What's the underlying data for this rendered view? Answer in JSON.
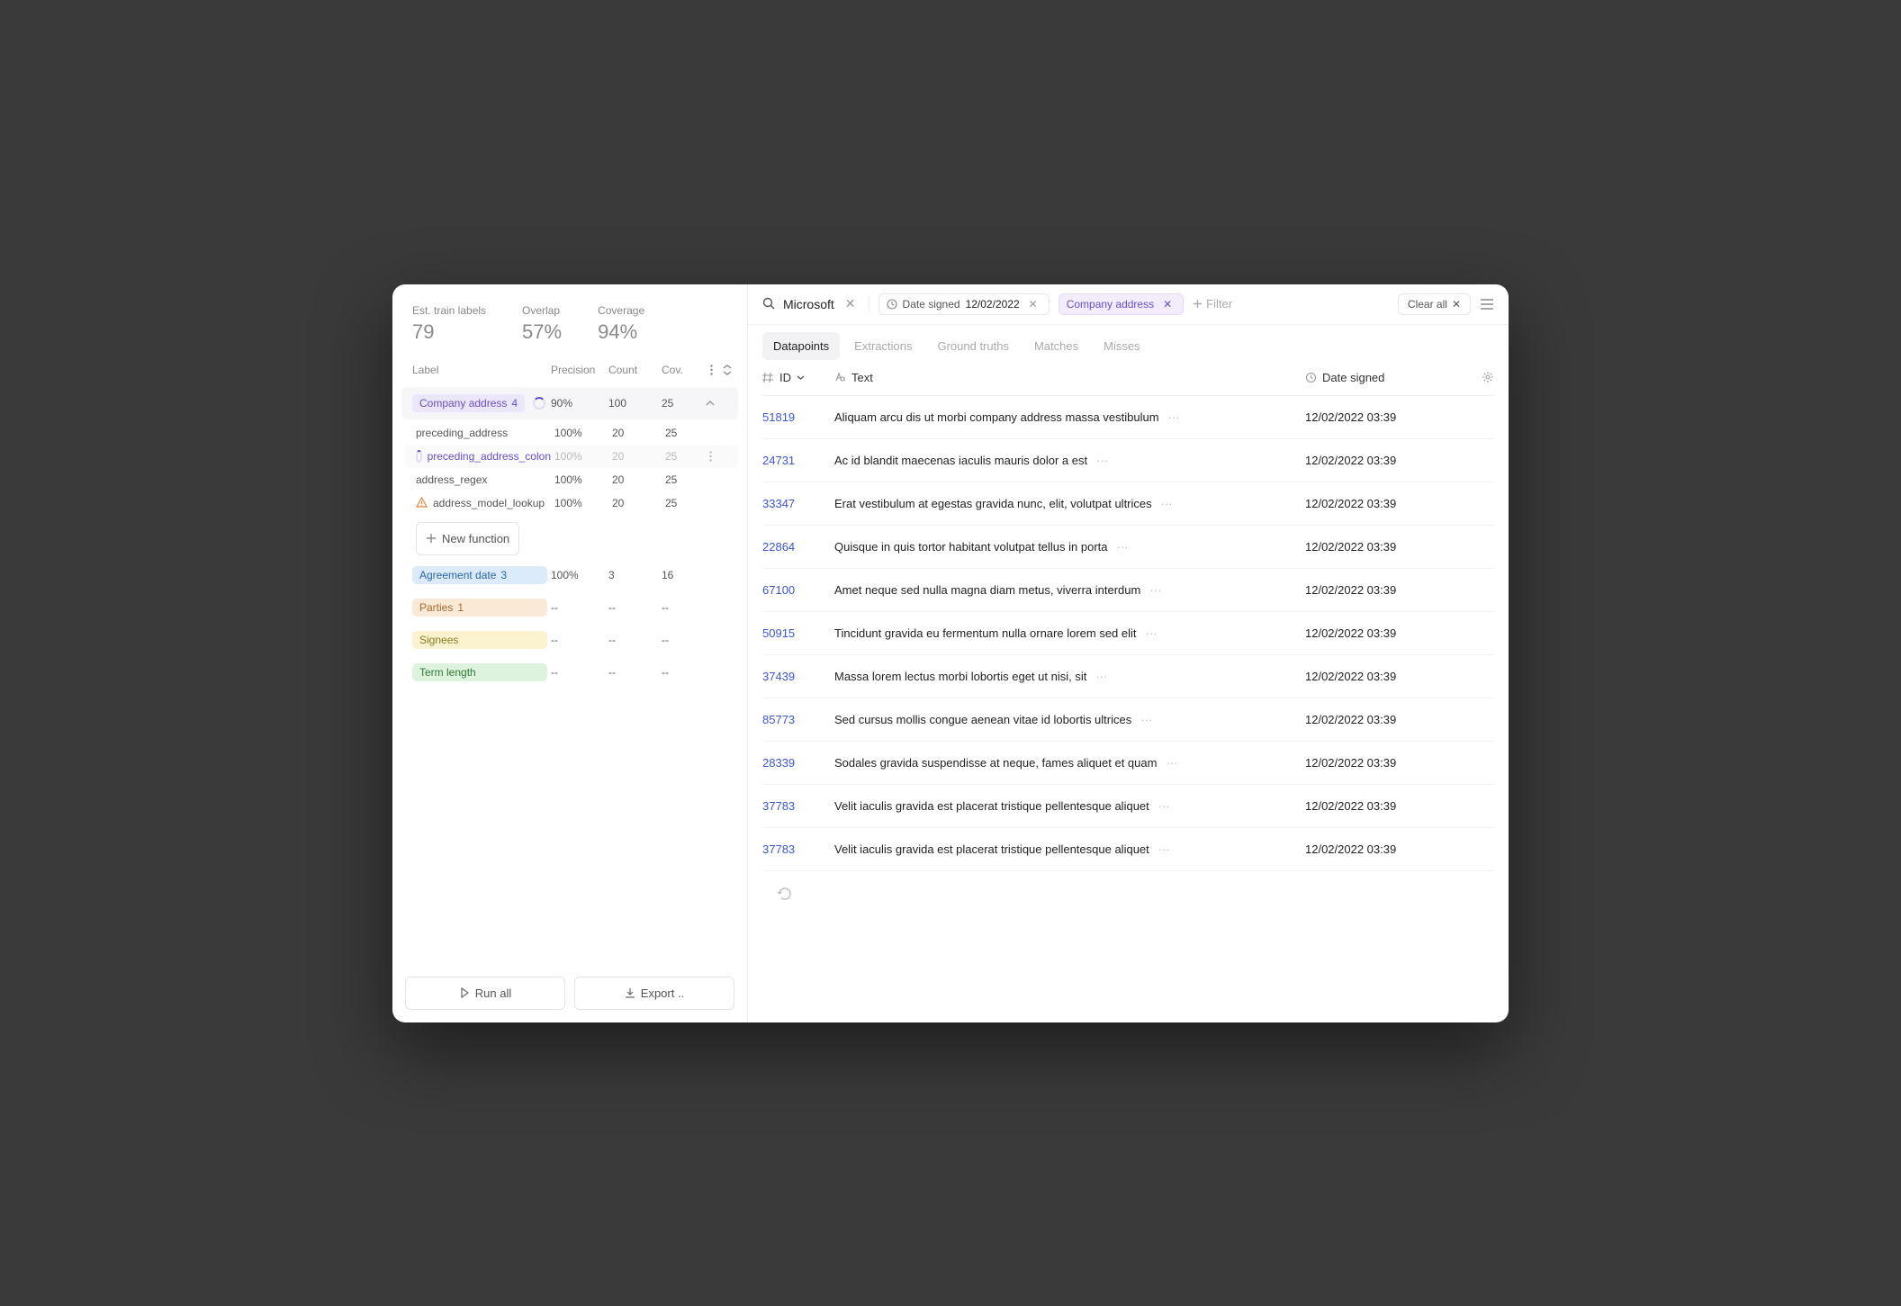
{
  "sidebar": {
    "metrics": [
      {
        "label": "Est. train labels",
        "value": "79"
      },
      {
        "label": "Overlap",
        "value": "57%"
      },
      {
        "label": "Coverage",
        "value": "94%"
      }
    ],
    "columns": {
      "label": "Label",
      "precision": "Precision",
      "count": "Count",
      "cov": "Cov."
    },
    "labels": [
      {
        "name": "Company address",
        "count_badge": "4",
        "color": "purple",
        "loading": true,
        "precision": "90%",
        "count": "100",
        "cov": "25",
        "expanded": true,
        "subs": [
          {
            "name": "preceding_address",
            "precision": "100%",
            "count": "20",
            "cov": "25"
          },
          {
            "name": "preceding_address_colon",
            "precision": "100%",
            "count": "20",
            "cov": "25",
            "loading": true,
            "active": true,
            "muted": true
          },
          {
            "name": "address_regex",
            "precision": "100%",
            "count": "20",
            "cov": "25"
          },
          {
            "name": "address_model_lookup",
            "precision": "100%",
            "count": "20",
            "cov": "25",
            "warn": true
          }
        ]
      },
      {
        "name": "Agreement date",
        "count_badge": "3",
        "color": "blue",
        "precision": "100%",
        "count": "3",
        "cov": "16"
      },
      {
        "name": "Parties",
        "count_badge": "1",
        "color": "orange",
        "precision": "--",
        "count": "--",
        "cov": "--"
      },
      {
        "name": "Signees",
        "color": "yellow",
        "precision": "--",
        "count": "--",
        "cov": "--"
      },
      {
        "name": "Term length",
        "color": "green",
        "precision": "--",
        "count": "--",
        "cov": "--"
      }
    ],
    "new_function": "New function",
    "footer": {
      "run_all": "Run all",
      "export": "Export .."
    }
  },
  "header": {
    "search_value": "Microsoft",
    "chips": [
      {
        "label": "Date signed",
        "value": "12/02/2022",
        "icon": "clock"
      },
      {
        "label": "Company address",
        "icon": "none",
        "purple": true
      }
    ],
    "filter_label": "Filter",
    "clear_all": "Clear all"
  },
  "tabs": [
    "Datapoints",
    "Extractions",
    "Ground truths",
    "Matches",
    "Misses"
  ],
  "active_tab": 0,
  "table": {
    "columns": {
      "id": "ID",
      "text": "Text",
      "date": "Date signed"
    },
    "rows": [
      {
        "id": "51819",
        "text": "Aliquam arcu dis ut morbi company address massa vestibulum",
        "date": "12/02/2022 03:39"
      },
      {
        "id": "24731",
        "text": "Ac id blandit maecenas iaculis mauris dolor a est",
        "date": "12/02/2022 03:39"
      },
      {
        "id": "33347",
        "text": "Erat vestibulum at egestas gravida nunc, elit, volutpat ultrices",
        "date": "12/02/2022 03:39"
      },
      {
        "id": "22864",
        "text": "Quisque in quis tortor habitant volutpat tellus in porta",
        "date": "12/02/2022 03:39"
      },
      {
        "id": "67100",
        "text": "Amet neque sed nulla magna diam metus, viverra interdum",
        "date": "12/02/2022 03:39"
      },
      {
        "id": "50915",
        "text": "Tincidunt gravida eu fermentum nulla ornare lorem sed elit",
        "date": "12/02/2022 03:39"
      },
      {
        "id": "37439",
        "text": "Massa lorem lectus morbi lobortis eget ut nisi, sit",
        "date": "12/02/2022 03:39"
      },
      {
        "id": "85773",
        "text": "Sed cursus mollis congue aenean vitae id lobortis ultrices",
        "date": "12/02/2022 03:39"
      },
      {
        "id": "28339",
        "text": "Sodales gravida suspendisse at neque, fames aliquet et quam",
        "date": "12/02/2022 03:39"
      },
      {
        "id": "37783",
        "text": "Velit iaculis gravida est placerat tristique pellentesque aliquet",
        "date": "12/02/2022 03:39"
      },
      {
        "id": "37783",
        "text": "Velit iaculis gravida est placerat tristique pellentesque aliquet",
        "date": "12/02/2022 03:39"
      }
    ]
  }
}
